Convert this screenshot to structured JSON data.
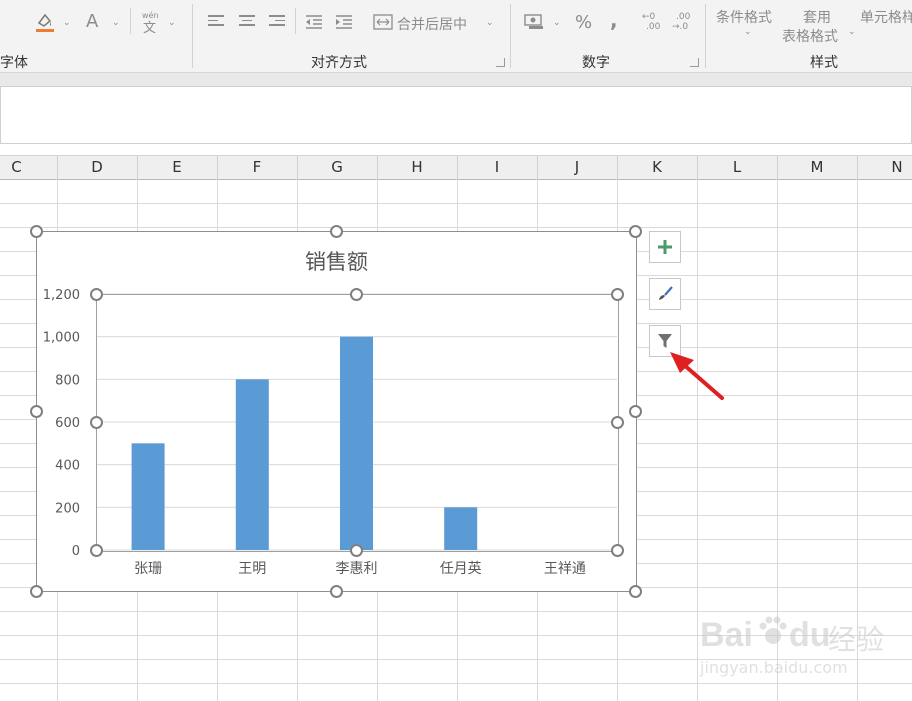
{
  "ribbon": {
    "groups": {
      "font": "字体",
      "alignment": "对齐方式",
      "number": "数字",
      "styles": "样式"
    },
    "merge_center": "合并后居中",
    "percent": "%",
    "comma": ",",
    "font_a": "A",
    "pinyin": "wén",
    "pinyin_char": "文",
    "inc_decimal_top": "←0",
    "inc_decimal_bottom": ".00",
    "dec_decimal_top": ".00",
    "dec_decimal_bottom": "→.0",
    "conditional_format": "条件格式",
    "table_format_line1": "套用",
    "table_format_line2": "表格格式",
    "cell_styles": "单元格样"
  },
  "columns": [
    "C",
    "D",
    "E",
    "F",
    "G",
    "H",
    "I",
    "J",
    "K",
    "L",
    "M",
    "N"
  ],
  "side_buttons": {
    "add_icon": "plus-icon",
    "style_icon": "brush-icon",
    "filter_icon": "filter-icon"
  },
  "colors": {
    "bar": "#5b9bd5",
    "arrow": "#e02020",
    "font_color_bar": "#ed7d31"
  },
  "watermark": {
    "brand": "Bai",
    "brand2": "du",
    "cn": "经验",
    "url": "jingyan.baidu.com"
  },
  "chart_data": {
    "type": "bar",
    "title": "销售额",
    "categories": [
      "张珊",
      "王明",
      "李惠利",
      "任月英",
      "王祥通"
    ],
    "values": [
      500,
      800,
      1000,
      200,
      0
    ],
    "yticks": [
      "0",
      "200",
      "400",
      "600",
      "800",
      "1,000",
      "1,200"
    ],
    "ylim": [
      0,
      1200
    ],
    "grid": true,
    "legend": "none"
  }
}
